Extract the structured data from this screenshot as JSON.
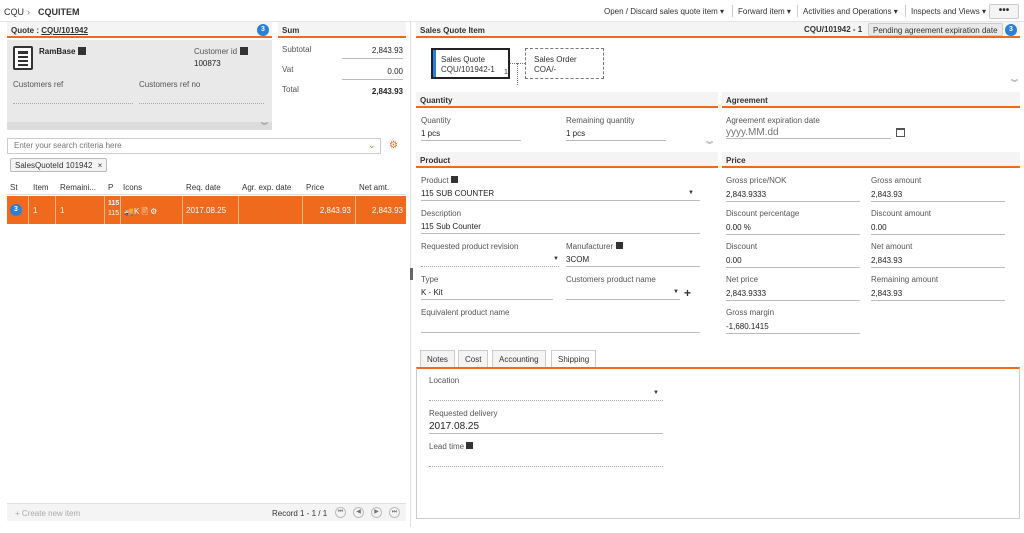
{
  "breadcrumb": {
    "root": "CQU",
    "separator": "›",
    "current": "CQUITEM"
  },
  "topmenu": {
    "open_discard": "Open / Discard sales quote item ▾",
    "forward": "Forward item ▾",
    "activities": "Activities and Operations ▾",
    "inspects": "Inspects and Views ▾",
    "more": "•••"
  },
  "quote": {
    "title": "Quote :",
    "number": "CQU/101942",
    "badge": "3",
    "customer_name": "RamBase",
    "customer_id_label": "Customer id",
    "customer_id": "100873",
    "customers_ref_label": "Customers ref",
    "customers_ref_no_label": "Customers ref no"
  },
  "sum": {
    "title": "Sum",
    "subtotal_label": "Subtotal",
    "subtotal": "2,843.93",
    "vat_label": "Vat",
    "vat": "0.00",
    "total_label": "Total",
    "total": "2,843.93"
  },
  "search": {
    "placeholder": "Enter your search criteria here",
    "filter_chip": "SalesQuoteId 101942"
  },
  "table": {
    "headers": [
      "St",
      "Item",
      "Remaini...",
      "P",
      "Icons",
      "Req. date",
      "Agr. exp. date",
      "Price",
      "Net amt."
    ],
    "row": {
      "st": "3",
      "item": "1",
      "remaining": "1",
      "p1": "115",
      "p2": "115",
      "icons": "🚚K 🖹 ⚙",
      "req_date": "2017.08.25",
      "agr_date": "",
      "price": "2,843.93",
      "net": "2,843.93"
    }
  },
  "footer": {
    "create": "+ Create new item",
    "record": "Record 1 - 1 / 1"
  },
  "right_header": {
    "title": "Sales Quote Item",
    "id": "CQU/101942 - 1",
    "status": "Pending agreement expiration date",
    "badge": "3"
  },
  "flow": {
    "sq_title": "Sales Quote",
    "sq_id": "CQU/101942-1",
    "sq_count": "1",
    "so_title": "Sales Order",
    "so_id": "COA/-"
  },
  "quantity": {
    "title": "Quantity",
    "qty_label": "Quantity",
    "qty": "1 pcs",
    "rem_label": "Remaining quantity",
    "rem": "1 pcs"
  },
  "agreement": {
    "title": "Agreement",
    "exp_label": "Agreement expiration date",
    "exp_placeholder": "yyyy.MM.dd"
  },
  "product": {
    "title": "Product",
    "product_label": "Product",
    "product": "115 SUB COUNTER",
    "desc_label": "Description",
    "desc": "115 Sub Counter",
    "rev_label": "Requested product revision",
    "manu_label": "Manufacturer",
    "manu": "3COM",
    "type_label": "Type",
    "type": "K - Kit",
    "cust_prod_label": "Customers product name",
    "equiv_label": "Equivalent product name"
  },
  "price": {
    "title": "Price",
    "gross_price_label": "Gross price/NOK",
    "gross_price": "2,843.9333",
    "gross_amount_label": "Gross amount",
    "gross_amount": "2,843.93",
    "disc_pct_label": "Discount percentage",
    "disc_pct": "0.00 %",
    "disc_amount_label": "Discount amount",
    "disc_amount": "0.00",
    "disc_label": "Discount",
    "disc": "0.00",
    "net_amount_label": "Net amount",
    "net_amount": "2,843.93",
    "net_price_label": "Net price",
    "net_price": "2,843.9333",
    "remaining_amount_label": "Remaining amount",
    "remaining_amount": "2,843.93",
    "gross_margin_label": "Gross margin",
    "gross_margin": "-1,680.1415"
  },
  "tabs": [
    "Notes",
    "Cost",
    "Accounting",
    "Shipping"
  ],
  "shipping": {
    "location_label": "Location",
    "req_delivery_label": "Requested delivery",
    "req_delivery": "2017.08.25",
    "lead_time_label": "Lead time"
  }
}
